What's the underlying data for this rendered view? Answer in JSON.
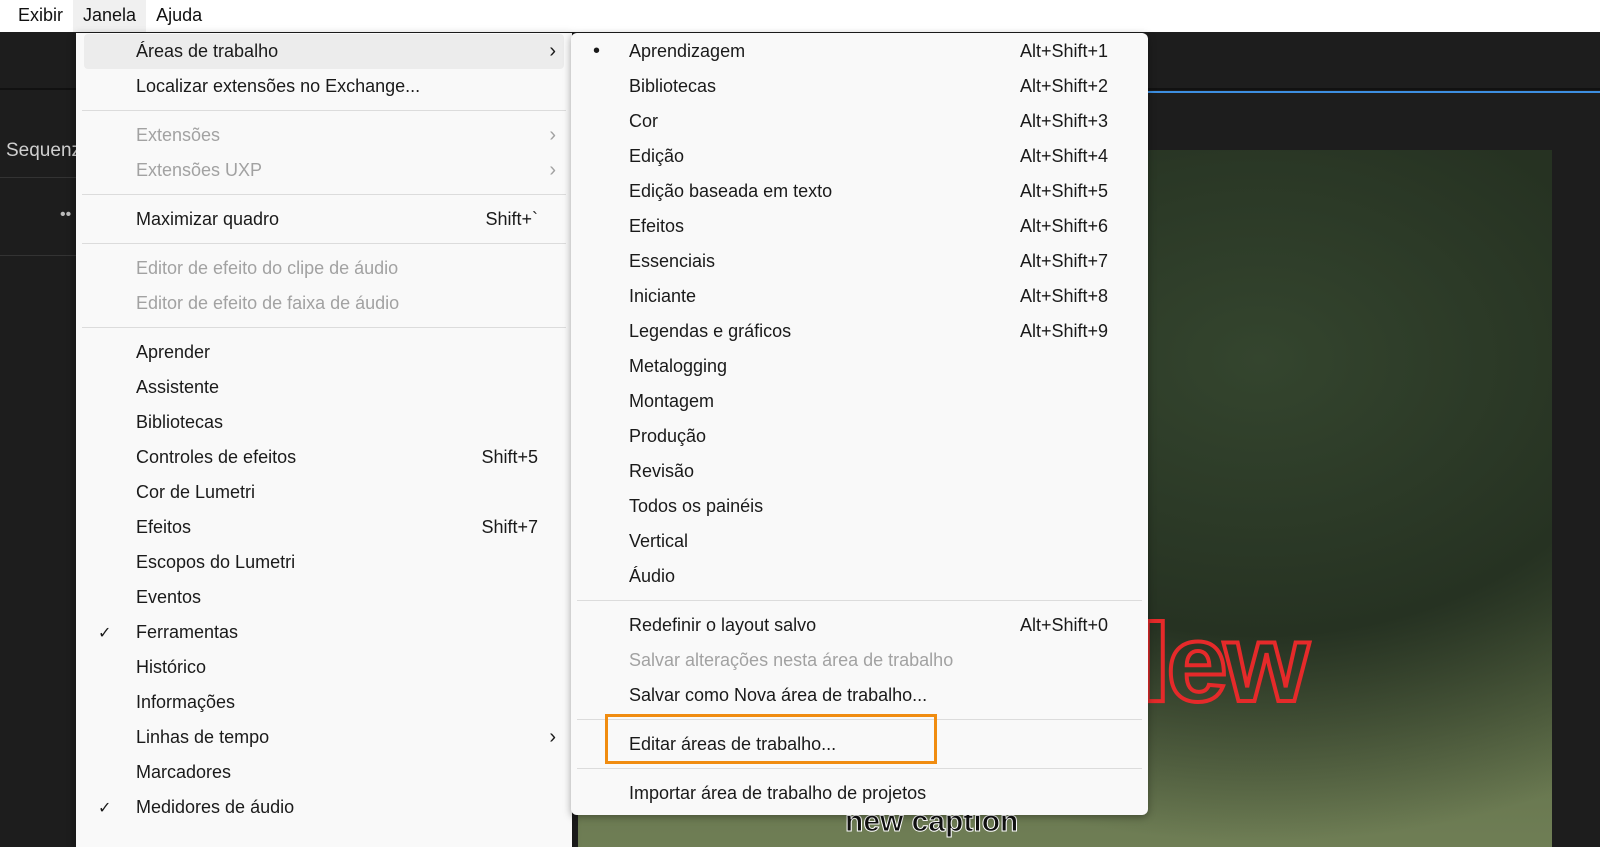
{
  "menubar": {
    "items": [
      "Exibir",
      "Janela",
      "Ajuda"
    ]
  },
  "background": {
    "panel_label": "Sequenz",
    "dots": "••",
    "overlay_text": "lew",
    "caption": "new caption"
  },
  "main_menu": {
    "groups": [
      [
        {
          "label": "Áreas de trabalho",
          "arrow": "›",
          "highlight": true
        },
        {
          "label": "Localizar extensões no Exchange..."
        }
      ],
      [
        {
          "label": "Extensões",
          "arrow": "›",
          "disabled": true
        },
        {
          "label": "Extensões UXP",
          "arrow": "›",
          "disabled": true
        }
      ],
      [
        {
          "label": "Maximizar quadro",
          "shortcut": "Shift+`"
        }
      ],
      [
        {
          "label": "Editor de efeito do clipe de áudio",
          "disabled": true
        },
        {
          "label": "Editor de efeito de faixa de áudio",
          "disabled": true
        }
      ],
      [
        {
          "label": "Aprender"
        },
        {
          "label": "Assistente"
        },
        {
          "label": "Bibliotecas"
        },
        {
          "label": "Controles de efeitos",
          "shortcut": "Shift+5"
        },
        {
          "label": "Cor de Lumetri"
        },
        {
          "label": "Efeitos",
          "shortcut": "Shift+7"
        },
        {
          "label": "Escopos do Lumetri"
        },
        {
          "label": "Eventos"
        },
        {
          "label": "Ferramentas",
          "mark": "✓"
        },
        {
          "label": "Histórico"
        },
        {
          "label": "Informações"
        },
        {
          "label": "Linhas de tempo",
          "arrow": "›"
        },
        {
          "label": "Marcadores"
        },
        {
          "label": "Medidores de áudio",
          "mark": "✓"
        }
      ]
    ]
  },
  "sub_menu": {
    "groups": [
      [
        {
          "label": "Aprendizagem",
          "shortcut": "Alt+Shift+1",
          "mark": "•"
        },
        {
          "label": "Bibliotecas",
          "shortcut": "Alt+Shift+2"
        },
        {
          "label": "Cor",
          "shortcut": "Alt+Shift+3"
        },
        {
          "label": "Edição",
          "shortcut": "Alt+Shift+4"
        },
        {
          "label": "Edição baseada em texto",
          "shortcut": "Alt+Shift+5"
        },
        {
          "label": "Efeitos",
          "shortcut": "Alt+Shift+6"
        },
        {
          "label": "Essenciais",
          "shortcut": "Alt+Shift+7"
        },
        {
          "label": "Iniciante",
          "shortcut": "Alt+Shift+8"
        },
        {
          "label": "Legendas e gráficos",
          "shortcut": "Alt+Shift+9"
        },
        {
          "label": "Metalogging"
        },
        {
          "label": "Montagem"
        },
        {
          "label": "Produção"
        },
        {
          "label": "Revisão"
        },
        {
          "label": "Todos os painéis"
        },
        {
          "label": "Vertical"
        },
        {
          "label": "Áudio"
        }
      ],
      [
        {
          "label": "Redefinir o layout salvo",
          "shortcut": "Alt+Shift+0"
        },
        {
          "label": "Salvar alterações nesta área de trabalho",
          "disabled": true
        },
        {
          "label": "Salvar como Nova área de trabalho..."
        }
      ],
      [
        {
          "label": "Editar áreas de trabalho...",
          "boxed": true
        }
      ],
      [
        {
          "label": "Importar área de trabalho de projetos"
        }
      ]
    ]
  },
  "colors": {
    "highlight_box": "#f08c10",
    "accent_line": "#3d8ee0",
    "overlay_text": "#e52a2a"
  }
}
